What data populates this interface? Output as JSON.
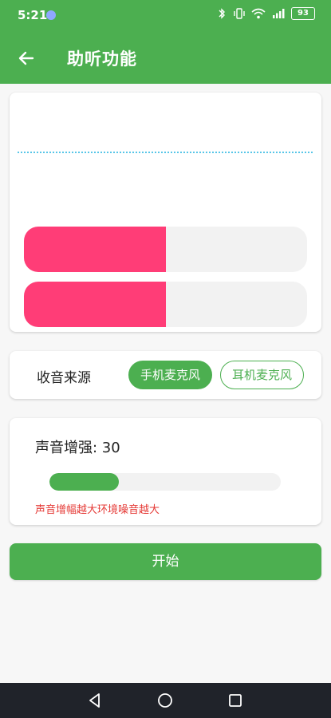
{
  "status_bar": {
    "time": "5:21",
    "battery": "93",
    "icons": [
      "bluetooth-icon",
      "vibrate-icon",
      "wifi-icon",
      "signal-icon",
      "battery-icon"
    ]
  },
  "app_bar": {
    "title": "助听功能",
    "back_icon": "arrow-left-icon"
  },
  "visualizer": {
    "level_bars": [
      0.5,
      0.5
    ]
  },
  "source": {
    "label": "收音来源",
    "options": [
      "手机麦克风",
      "耳机麦克风"
    ],
    "selected": "手机麦克风"
  },
  "boost": {
    "title": "声音增强: 30",
    "value": 30,
    "hint": "声音增幅越大环境噪音越大"
  },
  "start_button": "开始",
  "nav_bar": {
    "icons": [
      "back-triangle-icon",
      "home-circle-icon",
      "recent-square-icon"
    ]
  },
  "colors": {
    "primary": "#4caf50",
    "level": "#ff3d77",
    "wave": "#58c6e8",
    "hint": "#e53935",
    "nav": "#20232a"
  }
}
